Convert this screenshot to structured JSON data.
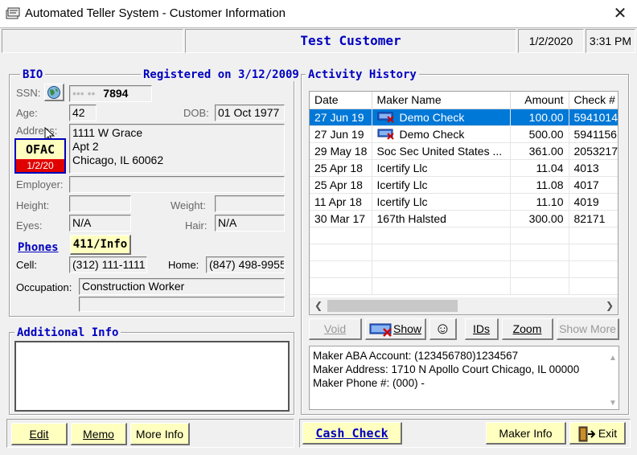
{
  "window": {
    "title": "Automated Teller System - Customer Information",
    "app_icon": "teller-app-icon",
    "close_icon": "close-icon"
  },
  "status": {
    "customer_name": "Test Customer",
    "date": "1/2/2020",
    "time": "3:31 PM"
  },
  "bio": {
    "legend": "BIO",
    "registered": "Registered on 3/12/2009",
    "ssn_label": "SSN:",
    "ssn_masked": "••• ••",
    "ssn_last4": "7894",
    "age_label": "Age:",
    "age": "42",
    "dob_label": "DOB:",
    "dob": "01 Oct 1977",
    "address_label": "Address:",
    "address_lines": [
      "1111 W Grace",
      "Apt 2",
      "Chicago, IL 60062"
    ],
    "ofac_label": "OFAC",
    "ofac_date": "1/2/20",
    "employer_label": "Employer:",
    "employer": "",
    "height_label": "Height:",
    "height": "",
    "weight_label": "Weight:",
    "weight": "",
    "eyes_label": "Eyes:",
    "eyes": "N/A",
    "hair_label": "Hair:",
    "hair": "N/A",
    "phones_label": "Phones",
    "info_button": "411/Info",
    "cell_label": "Cell:",
    "cell": "(312) 111-1111",
    "home_label": "Home:",
    "home": "(847) 498-9955",
    "occupation_label": "Occupation:",
    "occupation": "Construction Worker",
    "occupation2": ""
  },
  "additional_info": {
    "legend": "Additional Info",
    "text": ""
  },
  "activity": {
    "legend": "Activity History",
    "columns": [
      "Date",
      "Maker Name",
      "Amount",
      "Check #"
    ],
    "rows": [
      {
        "date": "27 Jun 19",
        "maker": "Demo Check",
        "amount": "100.00",
        "check": "5941014",
        "icon": true,
        "selected": true
      },
      {
        "date": "27 Jun 19",
        "maker": "Demo Check",
        "amount": "500.00",
        "check": "5941156",
        "icon": true,
        "selected": false
      },
      {
        "date": "29 May 18",
        "maker": "Soc Sec United States ...",
        "amount": "361.00",
        "check": "2053217",
        "icon": false,
        "selected": false
      },
      {
        "date": "25 Apr 18",
        "maker": "Icertify Llc",
        "amount": "11.04",
        "check": "4013",
        "icon": false,
        "selected": false
      },
      {
        "date": "25 Apr 18",
        "maker": "Icertify Llc",
        "amount": "11.08",
        "check": "4017",
        "icon": false,
        "selected": false
      },
      {
        "date": "11 Apr 18",
        "maker": "Icertify Llc",
        "amount": "11.10",
        "check": "4019",
        "icon": false,
        "selected": false
      },
      {
        "date": "30 Mar 17",
        "maker": "167th Halsted",
        "amount": "300.00",
        "check": "82171",
        "icon": false,
        "selected": false
      }
    ],
    "buttons": {
      "void": "Void",
      "show": "Show",
      "smiley": "☺",
      "ids": "IDs",
      "zoom": "Zoom",
      "show_more": "Show More"
    },
    "detail_lines": [
      "Maker ABA Account: (123456780)1234567",
      "Maker Address: 1710 N Apollo Court  Chicago, IL 00000",
      "Maker Phone #: (000) -"
    ]
  },
  "bottom": {
    "edit": "Edit",
    "memo": "Memo",
    "more_info": "More Info",
    "cash_check": "Cash Check",
    "maker_info": "Maker Info",
    "exit": "Exit"
  },
  "colors": {
    "accent_blue": "#0000c0",
    "button_yellow": "#ffffc0",
    "selection": "#0078d7",
    "ofac_red": "#e00000"
  }
}
